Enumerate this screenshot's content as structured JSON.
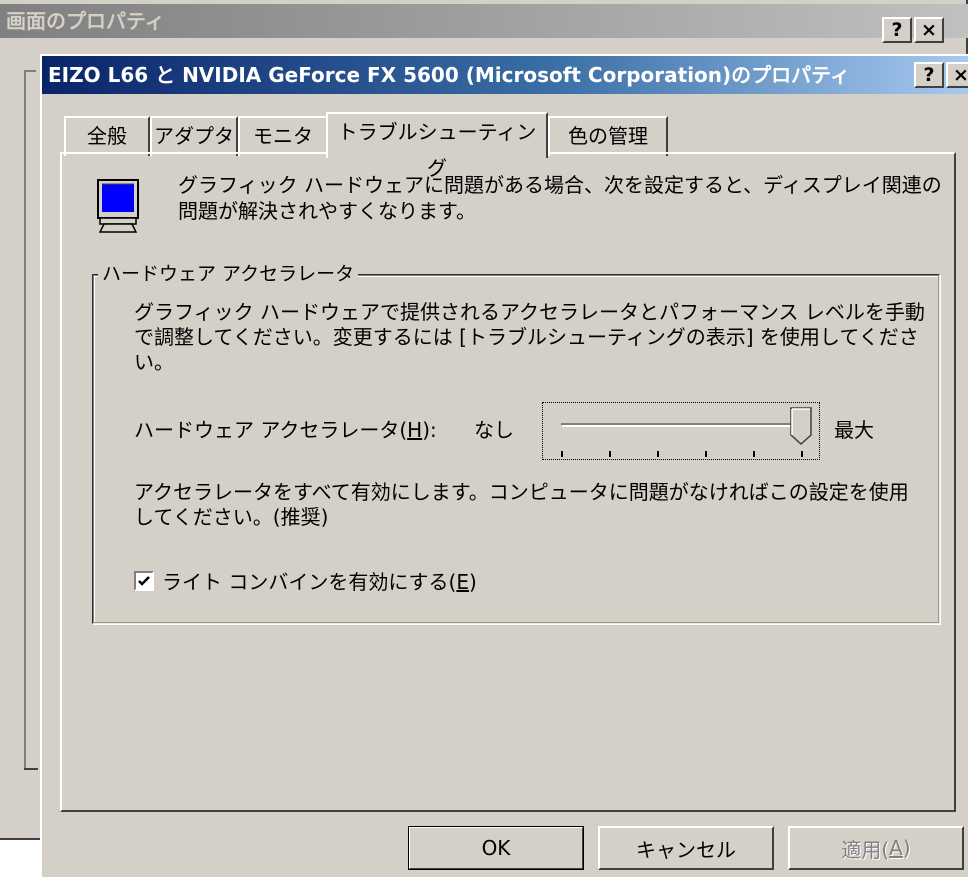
{
  "back_window": {
    "title": "画面のプロパティ",
    "help_button": "?",
    "close_button": "×"
  },
  "dialog": {
    "title": "EIZO L66 と NVIDIA GeForce FX 5600 (Microsoft Corporation)のプロパティ",
    "help_button": "?",
    "close_button": "×"
  },
  "tabs": [
    {
      "label": "全般",
      "active": false
    },
    {
      "label": "アダプタ",
      "active": false
    },
    {
      "label": "モニタ",
      "active": false
    },
    {
      "label": "トラブルシューティング",
      "active": true
    },
    {
      "label": "色の管理",
      "active": false
    }
  ],
  "troubleshoot": {
    "icon": "monitor-icon",
    "intro": "グラフィック ハードウェアに問題がある場合、次を設定すると、ディスプレイ関連の問題が解決されやすくなります。",
    "group_title": "ハードウェア アクセラレータ",
    "group_desc": "グラフィック ハードウェアで提供されるアクセラレータとパフォーマンス レベルを手動で調整してください。変更するには [トラブルシューティングの表示] を使用してください。",
    "accel_label": "ハードウェア アクセラレータ(",
    "accel_mnemonic": "H",
    "accel_label_end": "):",
    "slider_min_label": "なし",
    "slider_max_label": "最大",
    "slider_value_fraction": 1.0,
    "slider_ticks": 6,
    "accel_desc": "アクセラレータをすべて有効にします。コンピュータに問題がなければこの設定を使用してください。(推奨)",
    "checkbox_label": "ライト コンバインを有効にする(",
    "checkbox_mnemonic": "E",
    "checkbox_label_end": ")",
    "checkbox_checked": true
  },
  "buttons": {
    "ok": "OK",
    "cancel": "キャンセル",
    "apply_prefix": "適用(",
    "apply_mnemonic": "A",
    "apply_suffix": ")"
  }
}
